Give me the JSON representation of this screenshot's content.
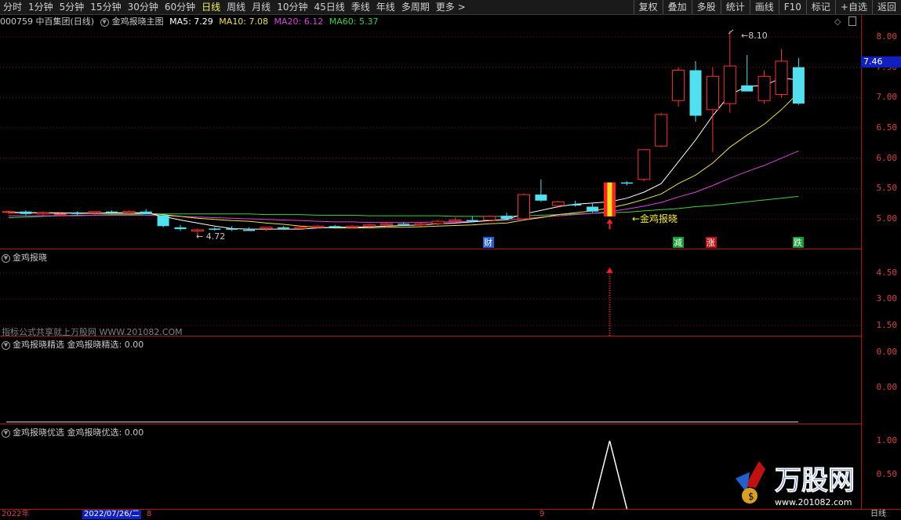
{
  "toolbar": {
    "timeframes": [
      "分时",
      "1分钟",
      "5分钟",
      "15分钟",
      "30分钟",
      "60分钟",
      "日线",
      "周线",
      "月线",
      "10分钟",
      "45日线",
      "季线",
      "年线",
      "多周期",
      "更多 >"
    ],
    "active": "日线",
    "right_tools": [
      "复权",
      "叠加",
      "多股",
      "统计",
      "画线",
      "F10",
      "标记",
      "+自选",
      "返回"
    ]
  },
  "info": {
    "stock": "000759 中百集团(日线)",
    "indicator": "金鸡报晓主图",
    "ma5": "MA5: 7.29",
    "ma10": "MA10: 7.08",
    "ma20": "MA20: 6.12",
    "ma60": "MA60: 5.37"
  },
  "colors": {
    "ma5": "#ffffff",
    "ma10": "#f0e040",
    "ma20": "#e040e0",
    "ma60": "#40d040",
    "up": "#ff3030",
    "down": "#50e0f0",
    "axis": "#d84040"
  },
  "main_axis": {
    "labels": [
      "8.00",
      "7.50",
      "7.00",
      "6.50",
      "6.00",
      "5.50",
      "5.00"
    ],
    "current": "7.46"
  },
  "annotations": {
    "high": "8.10",
    "low": "4.72",
    "signal": "金鸡报晓",
    "marks": [
      "财",
      "减",
      "涨",
      "跌"
    ]
  },
  "panel1": {
    "title": "金鸡报晓",
    "axis": [
      "4.50",
      "3.00",
      "1.50"
    ],
    "watermark": "指标公式共享就上万股网 WWW.201082.COM"
  },
  "panel2": {
    "title": "金鸡报晓精选 金鸡报晓精选: 0.00",
    "axis": [
      "0.00",
      "0.00"
    ]
  },
  "panel3": {
    "title": "金鸡报晓优选 金鸡报晓优选: 0.00",
    "axis": [
      "1.00",
      "0.50"
    ]
  },
  "bottom": {
    "year": "2022年",
    "date": "2022/07/26/二",
    "m1": "8",
    "m2": "9",
    "period": "日线"
  },
  "logo": {
    "text": "万股网",
    "url": "www.201082.com"
  },
  "chart_data": {
    "type": "candlestick",
    "ylim": [
      4.6,
      8.2
    ],
    "candles": [
      [
        5.12,
        5.14,
        5.08,
        5.12
      ],
      [
        5.12,
        5.14,
        5.06,
        5.08
      ],
      [
        5.08,
        5.12,
        5.06,
        5.1
      ],
      [
        5.08,
        5.1,
        5.06,
        5.08
      ],
      [
        5.1,
        5.12,
        5.06,
        5.08
      ],
      [
        5.1,
        5.12,
        5.06,
        5.12
      ],
      [
        5.12,
        5.14,
        5.08,
        5.1
      ],
      [
        5.1,
        5.14,
        5.08,
        5.12
      ],
      [
        5.12,
        5.16,
        5.08,
        5.08
      ],
      [
        5.06,
        5.08,
        4.86,
        4.88
      ],
      [
        4.86,
        4.9,
        4.8,
        4.83
      ],
      [
        4.8,
        4.84,
        4.72,
        4.82
      ],
      [
        4.84,
        4.86,
        4.8,
        4.82
      ],
      [
        4.84,
        4.88,
        4.8,
        4.82
      ],
      [
        4.82,
        4.86,
        4.8,
        4.8
      ],
      [
        4.84,
        4.86,
        4.8,
        4.86
      ],
      [
        4.86,
        4.88,
        4.82,
        4.84
      ],
      [
        4.84,
        4.88,
        4.82,
        4.86
      ],
      [
        4.86,
        4.9,
        4.84,
        4.88
      ],
      [
        4.88,
        4.9,
        4.84,
        4.86
      ],
      [
        4.86,
        4.9,
        4.84,
        4.88
      ],
      [
        4.88,
        4.92,
        4.86,
        4.9
      ],
      [
        4.9,
        4.94,
        4.86,
        4.92
      ],
      [
        4.92,
        4.94,
        4.88,
        4.9
      ],
      [
        4.9,
        4.94,
        4.88,
        4.92
      ],
      [
        4.92,
        4.98,
        4.9,
        4.96
      ],
      [
        4.96,
        5.02,
        4.94,
        4.98
      ],
      [
        4.98,
        5.04,
        4.94,
        4.96
      ],
      [
        4.98,
        5.06,
        4.96,
        5.04
      ],
      [
        5.05,
        5.1,
        4.98,
        5.0
      ],
      [
        5.0,
        5.42,
        5.0,
        5.4
      ],
      [
        5.4,
        5.65,
        5.28,
        5.3
      ],
      [
        5.22,
        5.3,
        5.18,
        5.28
      ],
      [
        5.24,
        5.3,
        5.2,
        5.22
      ],
      [
        5.2,
        5.25,
        5.1,
        5.12
      ],
      [
        5.1,
        5.6,
        5.1,
        5.6
      ],
      [
        5.6,
        5.62,
        5.55,
        5.58
      ],
      [
        5.65,
        6.15,
        5.62,
        6.14
      ],
      [
        6.2,
        6.75,
        6.18,
        6.72
      ],
      [
        6.95,
        7.5,
        6.85,
        7.45
      ],
      [
        7.45,
        7.6,
        6.6,
        6.7
      ],
      [
        6.8,
        7.5,
        6.1,
        7.35
      ],
      [
        6.9,
        8.1,
        6.75,
        7.52
      ],
      [
        7.2,
        7.7,
        7.1,
        7.1
      ],
      [
        6.95,
        7.45,
        6.9,
        7.35
      ],
      [
        7.05,
        7.8,
        7.0,
        7.6
      ],
      [
        7.5,
        7.65,
        6.88,
        6.9
      ]
    ],
    "ma5": [
      5.11,
      5.1,
      5.1,
      5.09,
      5.1,
      5.09,
      5.1,
      5.1,
      5.1,
      5.04,
      4.98,
      4.93,
      4.88,
      4.84,
      4.83,
      4.83,
      4.83,
      4.83,
      4.85,
      4.86,
      4.86,
      4.87,
      4.88,
      4.89,
      4.9,
      4.92,
      4.93,
      4.95,
      4.97,
      4.99,
      5.08,
      5.14,
      5.2,
      5.24,
      5.26,
      5.28,
      5.34,
      5.44,
      5.58,
      5.94,
      6.3,
      6.7,
      7.05,
      7.18,
      7.2,
      7.32,
      7.29
    ],
    "ma10": [
      5.1,
      5.1,
      5.1,
      5.1,
      5.09,
      5.09,
      5.09,
      5.09,
      5.09,
      5.07,
      5.04,
      5.01,
      4.99,
      4.97,
      4.96,
      4.93,
      4.91,
      4.88,
      4.86,
      4.85,
      4.85,
      4.85,
      4.86,
      4.86,
      4.87,
      4.88,
      4.89,
      4.9,
      4.92,
      4.93,
      4.98,
      5.02,
      5.07,
      5.1,
      5.13,
      5.18,
      5.24,
      5.32,
      5.41,
      5.58,
      5.72,
      5.92,
      6.18,
      6.38,
      6.56,
      6.8,
      7.08
    ],
    "ma20": [
      5.05,
      5.05,
      5.05,
      5.05,
      5.05,
      5.06,
      5.06,
      5.06,
      5.06,
      5.05,
      5.04,
      5.03,
      5.02,
      5.01,
      5.0,
      4.99,
      4.98,
      4.97,
      4.96,
      4.95,
      4.95,
      4.94,
      4.94,
      4.94,
      4.94,
      4.95,
      4.95,
      4.96,
      4.97,
      4.98,
      5.0,
      5.03,
      5.05,
      5.07,
      5.09,
      5.12,
      5.16,
      5.21,
      5.27,
      5.36,
      5.44,
      5.55,
      5.67,
      5.78,
      5.88,
      6.0,
      6.12
    ],
    "ma60": [
      5.02,
      5.03,
      5.04,
      5.05,
      5.06,
      5.06,
      5.07,
      5.07,
      5.08,
      5.08,
      5.08,
      5.08,
      5.08,
      5.08,
      5.08,
      5.07,
      5.07,
      5.07,
      5.06,
      5.06,
      5.06,
      5.05,
      5.05,
      5.05,
      5.05,
      5.05,
      5.04,
      5.04,
      5.04,
      5.04,
      5.05,
      5.06,
      5.07,
      5.08,
      5.09,
      5.1,
      5.11,
      5.13,
      5.15,
      5.17,
      5.2,
      5.22,
      5.25,
      5.28,
      5.31,
      5.34,
      5.37
    ],
    "signal_index": 35,
    "panel3_peak_index": 35
  }
}
